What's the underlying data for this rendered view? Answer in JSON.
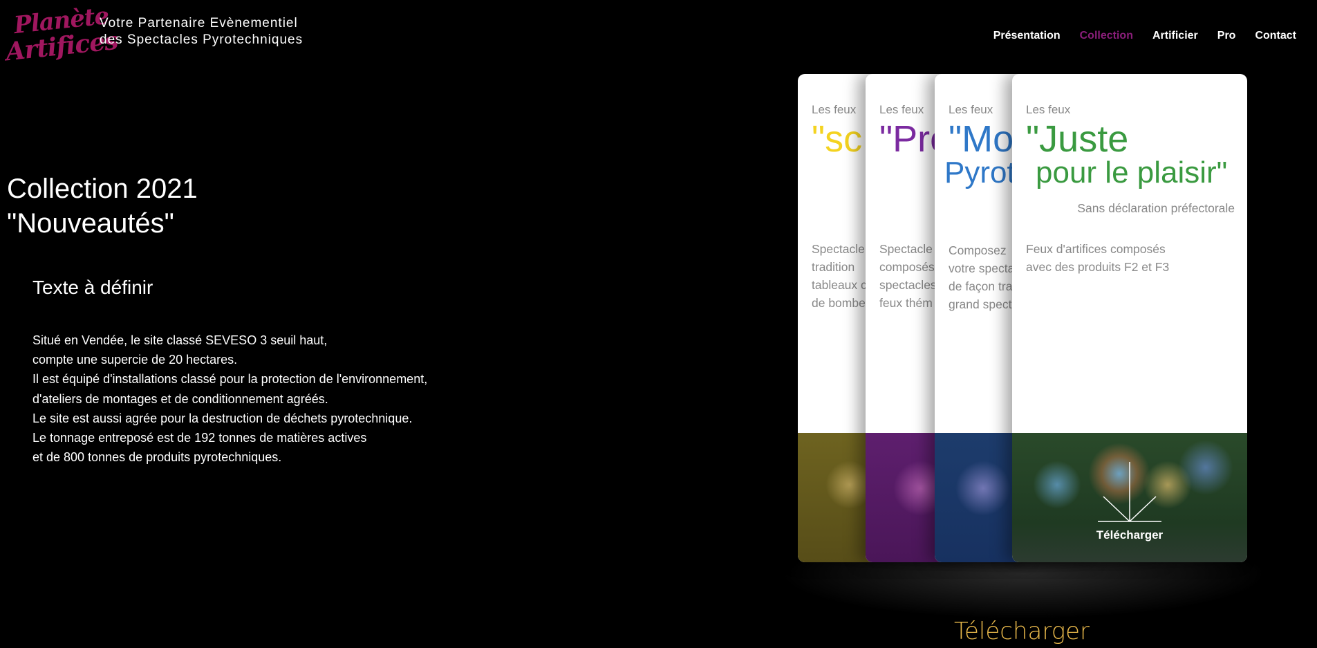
{
  "header": {
    "logo_text_1": "Planète",
    "logo_text_2": "Artifices",
    "tagline_line1": "Votre Partenaire Evènementiel",
    "tagline_line2": "des Spectacles Pyrotechniques",
    "nav": [
      "Présentation",
      "Collection",
      "Artificier",
      "Pro",
      "Contact"
    ],
    "active_nav": "Collection",
    "colors": {
      "active": "#8a1e7a",
      "logo": "#a0175f"
    }
  },
  "main": {
    "title_line1": "Collection 2021",
    "title_line2": "\"Nouveautés\"",
    "subtitle": "Texte à définir",
    "paragraph": [
      "Situé en Vendée, le site classé SEVESO 3 seuil haut,",
      "compte une supercie de 20 hectares.",
      "Il est équipé d'installations classé pour la protection de l'environnement,",
      "d'ateliers de montages et de conditionnement agréés.",
      "Le site est aussi agrée pour la destruction de déchets pyrotechnique.",
      "Le tonnage entreposé est de 192 tonnes de matières actives",
      "et de 800 tonnes de produits pyrotechniques."
    ]
  },
  "cards": [
    {
      "top": "Les feux",
      "big": "\"sc",
      "desc": [
        "Spectacle",
        "tradition",
        "tableaux c",
        "de bombe"
      ],
      "color": "#f4d320"
    },
    {
      "top": "Les feux",
      "big": "\"Pre",
      "desc": [
        "Spectacle",
        "composés",
        "spectacles",
        "feux thém"
      ],
      "color": "#7b2aa0"
    },
    {
      "top": "Les feux",
      "big": "\"Mod",
      "big2": "Pyrot",
      "desc": [
        "Composez",
        "votre specta",
        "de façon tra",
        "grand spect"
      ],
      "color": "#2f78c8"
    },
    {
      "top": "Les feux",
      "big": "\"Juste",
      "big2": "pour le plaisir\"",
      "note": "Sans déclaration préfectorale",
      "desc": [
        "Feux d'artifices composés",
        "avec des produits F2 et F3"
      ],
      "download_label": "Télécharger",
      "color": "#3a9a40"
    }
  ],
  "footer": {
    "download_label": "Télécharger",
    "color": "#e8b84a"
  }
}
